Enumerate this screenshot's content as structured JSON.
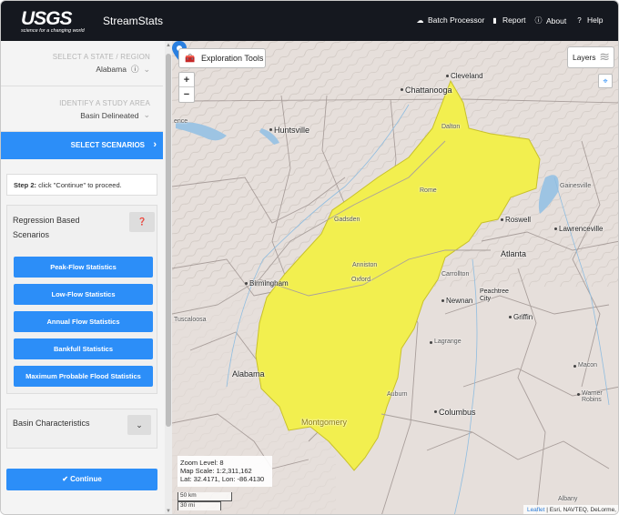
{
  "header": {
    "logo_text": "USGS",
    "logo_tagline": "science for a changing world",
    "app_name": "StreamStats",
    "nav": [
      {
        "label": "Batch Processor",
        "icon": "cloud-icon"
      },
      {
        "label": "Report",
        "icon": "bookmark-icon"
      },
      {
        "label": "About",
        "icon": "info-icon"
      },
      {
        "label": "Help",
        "icon": "question-icon"
      }
    ]
  },
  "sidebar": {
    "state_label": "SELECT A STATE / REGION",
    "state_value": "Alabama",
    "study_label": "IDENTIFY A STUDY AREA",
    "study_value": "Basin Delineated",
    "scenarios_label": "SELECT SCENARIOS",
    "step_bold": "Step 2:",
    "step_text": " click \"Continue\" to proceed.",
    "regression_title": "Regression Based Scenarios",
    "scenario_buttons": [
      "Peak-Flow Statistics",
      "Low-Flow Statistics",
      "Annual Flow Statistics",
      "Bankfull Statistics",
      "Maximum Probable Flood Statistics"
    ],
    "basin_title": "Basin Characteristics",
    "continue_label": "Continue"
  },
  "map": {
    "exploration_label": "Exploration Tools",
    "layers_label": "Layers",
    "zoom_in": "+",
    "zoom_out": "−",
    "zoom_level": "Zoom Level: 8",
    "map_scale": "Map Scale: 1:2,311,162",
    "latlon": "Lat: 32.4171, Lon: -86.4130",
    "scale_km": "50 km",
    "scale_mi": "30 mi",
    "attribution_link": "Leaflet",
    "attribution_text": "| Esri, NAVTEQ, DeLorme,",
    "basin_color": "#f2ef4f",
    "places": {
      "cleveland": "Cleveland",
      "chattanooga": "Chattanooga",
      "huntsville": "Huntsville",
      "ence": "ence",
      "dalton": "Dalton",
      "rome": "Rome",
      "gainesville": "Gainesville",
      "gadsden": "Gadsden",
      "roswell": "Roswell",
      "lawrenceville": "Lawrenceville",
      "atlanta": "Atlanta",
      "anniston": "Anniston",
      "oxford": "Oxford",
      "carrollton": "Carrollton",
      "birmingham": "Birmingham",
      "newnan": "Newnan",
      "peachtree": "Peachtree City",
      "griffin": "Griffin",
      "tuscaloosa": "Tuscaloosa",
      "lagrange": "Lagrange",
      "alabama": "Alabama",
      "macon": "Macon",
      "auburn": "Auburn",
      "warner_robins": "Warner Robins",
      "columbus": "Columbus",
      "montgomery": "Montgomery",
      "albany": "Albany"
    }
  }
}
